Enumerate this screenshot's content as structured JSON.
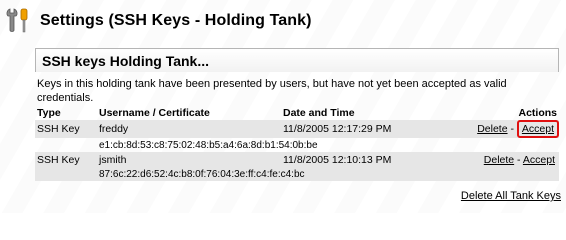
{
  "header": {
    "title": "Settings (SSH Keys - Holding Tank)",
    "icon": "tools-icon"
  },
  "panel": {
    "title": "SSH keys Holding Tank...",
    "description": "Keys in this holding tank have been presented by users, but have not yet been accepted as valid credentials."
  },
  "table": {
    "headers": {
      "type": "Type",
      "username": "Username / Certificate",
      "date": "Date and Time",
      "actions": "Actions"
    },
    "rows": [
      {
        "type": "SSH Key",
        "username": "freddy",
        "datetime": "11/8/2005 12:17:29 PM",
        "fingerprint": "e1:cb:8d:53:c8:75:02:48:b5:a4:6a:8d:b1:54:0b:be",
        "delete_label": "Delete",
        "sep": "-",
        "accept_label": "Accept"
      },
      {
        "type": "SSH Key",
        "username": "jsmith",
        "datetime": "11/8/2005 12:10:13 PM",
        "fingerprint": "87:6c:22:d6:52:4c:b8:0f:76:04:3e:ff:c4:fe:c4:bc",
        "delete_label": "Delete",
        "sep": "-",
        "accept_label": "Accept"
      }
    ]
  },
  "footer": {
    "delete_all_label": "Delete All Tank Keys"
  },
  "colors": {
    "highlight": "#e01010",
    "row_bg": "#e6e6e6"
  }
}
